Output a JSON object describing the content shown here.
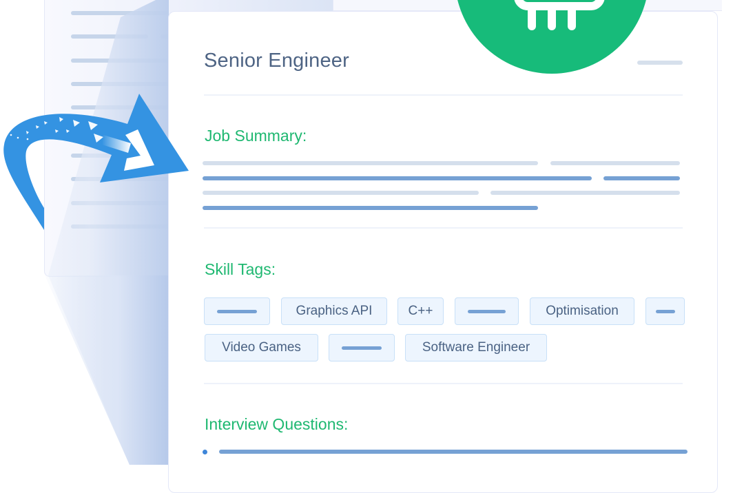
{
  "job": {
    "title": "Senior Engineer"
  },
  "sections": {
    "summary_heading": "Job Summary:",
    "skills_heading": "Skill Tags:",
    "questions_heading": "Interview Questions:"
  },
  "skill_tags": [
    {
      "label": "",
      "placeholder": true
    },
    {
      "label": "Graphics API",
      "placeholder": false
    },
    {
      "label": "C++",
      "placeholder": false
    },
    {
      "label": "",
      "placeholder": true
    },
    {
      "label": "Optimisation",
      "placeholder": false
    },
    {
      "label": "",
      "placeholder": true
    },
    {
      "label": "Video Games",
      "placeholder": false
    },
    {
      "label": "",
      "placeholder": true
    },
    {
      "label": "Software Engineer",
      "placeholder": false
    }
  ],
  "icons": {
    "badge": "cpu-chip-icon",
    "arrow": "curved-arrow-icon"
  },
  "colors": {
    "accent_green": "#17bb7a",
    "heading_green": "#1fb871",
    "title_slate": "#4e6484",
    "arrow_blue": "#3493e2",
    "tag_bg": "#edf5fe",
    "tag_border": "#c8e0f8",
    "placeholder_dark": "#76a1d4",
    "placeholder_light": "#d5dfec"
  }
}
